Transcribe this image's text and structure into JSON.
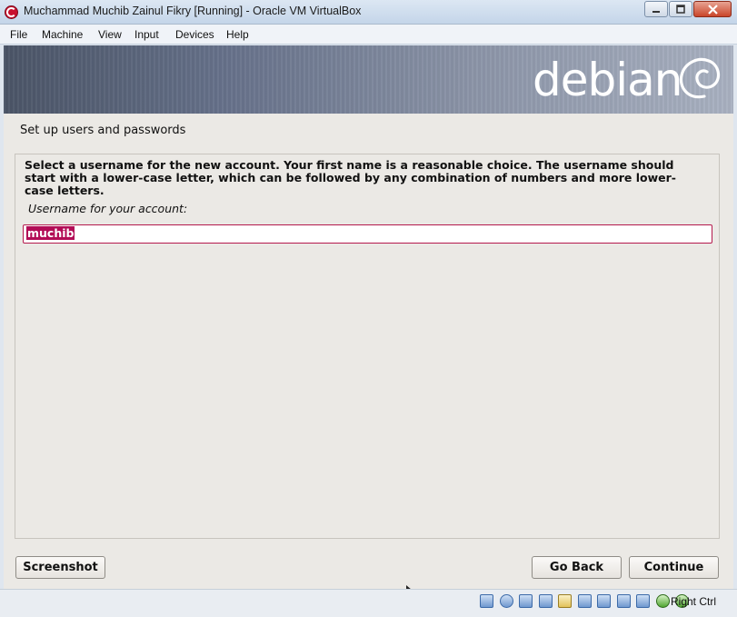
{
  "window": {
    "title": "Muchammad Muchib Zainul Fikry [Running] - Oracle VM VirtualBox",
    "icon": "virtualbox-icon",
    "controls": {
      "minimize": "minimize-icon",
      "maximize": "maximize-icon",
      "close": "close-icon"
    }
  },
  "menubar": {
    "items": [
      "File",
      "Machine",
      "View",
      "Input",
      "Devices",
      "Help"
    ]
  },
  "installer": {
    "brand": "debian",
    "step_title": "Set up users and passwords",
    "instructions": "Select a username for the new account. Your first name is a reasonable choice. The username should start with a lower-case letter, which can be followed by any combination of numbers and more lower-case letters.",
    "field_label": "Username for your account:",
    "username_value": "muchib",
    "buttons": {
      "screenshot": "Screenshot",
      "go_back": "Go Back",
      "continue": "Continue"
    },
    "colors": {
      "accent": "#b20c56",
      "background": "#ebe9e5"
    }
  },
  "statusbar": {
    "icons": [
      "hard-disk-icon",
      "optical-drive-icon",
      "audio-icon",
      "network-icon",
      "usb-icon",
      "shared-folders-icon",
      "display-icon",
      "video-capture-icon",
      "cpu-icon",
      "mouse-integration-icon",
      "keyboard-capture-icon"
    ],
    "host_key": "Right Ctrl"
  }
}
